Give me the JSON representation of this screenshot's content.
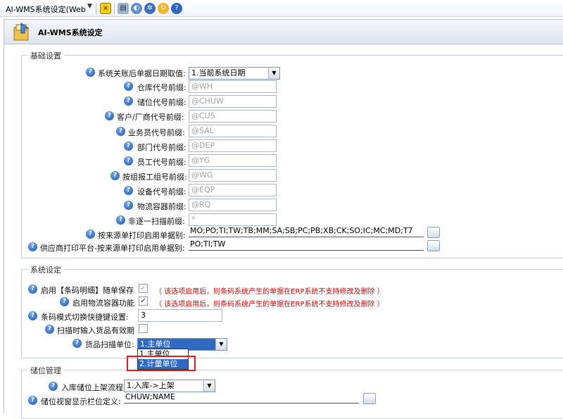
{
  "toolbar": {
    "tab_title": "AI-WMS系统设定(Web",
    "icons": [
      "exit-icon",
      "copy-icon",
      "picture-icon",
      "gear-icon",
      "refresh-icon",
      "help-icon"
    ]
  },
  "header": {
    "title": "AI-WMS系统设定"
  },
  "basic": {
    "legend": "基础设置",
    "rows": [
      {
        "label": "系统关账后单据日期取值:",
        "value": "1.当前系统日期"
      },
      {
        "label": "仓库代号前缀:",
        "placeholder": "@WH"
      },
      {
        "label": "储位代号前缀:",
        "placeholder": "@CHUW"
      },
      {
        "label": "客户/厂商代号前缀:",
        "placeholder": "@CUS"
      },
      {
        "label": "业务员代号前缀:",
        "placeholder": "@SAL"
      },
      {
        "label": "部门代号前缀:",
        "placeholder": "@DEP"
      },
      {
        "label": "员工代号前缀:",
        "placeholder": "@YG"
      },
      {
        "label": "按组报工组号前缀:",
        "placeholder": "@WG"
      },
      {
        "label": "设备代号前缀:",
        "placeholder": "@EQP"
      },
      {
        "label": "物流容器前缀:",
        "placeholder": "@RQ"
      },
      {
        "label": "非逐一扫描前缀:",
        "placeholder": "*"
      },
      {
        "label": "按来源单打印启用单据别:",
        "value": "MO;PO;TI;TW;TB;MM;SA;SB;PC;PB;XB;CK;SO;IC;MC;MD;T7"
      },
      {
        "label": "供应商打印平台-按来源单打印启用单据别:",
        "value": "PO;TI;TW"
      }
    ]
  },
  "system": {
    "legend": "系统设定",
    "barcode_detail": {
      "label": "启用【条码明细】随单保存",
      "checked": false,
      "note": "（ 该选项启用后，则条码系统产生的单据在ERP系统不支持修改及删除 ）"
    },
    "container": {
      "label": "启用物流容器功能",
      "checked": true,
      "note": "（ 该选项启用后，则条码系统产生的单据在ERP系统不支持修改及删除 ）"
    },
    "hotkey": {
      "label": "条码模式切换快捷键设置:",
      "value": "3"
    },
    "expiry": {
      "label": "扫描时输入货品有效期",
      "checked": false
    },
    "scan_unit": {
      "label": "货品扫描单位:",
      "value": "1.主单位",
      "options": [
        "1.主单位",
        "2.计量单位"
      ]
    }
  },
  "location": {
    "legend": "储位管理",
    "flow": {
      "label": "入库储位上架流程",
      "value": "1.入库->上架"
    },
    "columns": {
      "label": "储位视窗显示栏位定义:",
      "value": "CHUW;NAME"
    }
  },
  "colors": {
    "accent": "#316ac5",
    "warning": "#e00000",
    "highlight_box": "#e41b1b"
  }
}
